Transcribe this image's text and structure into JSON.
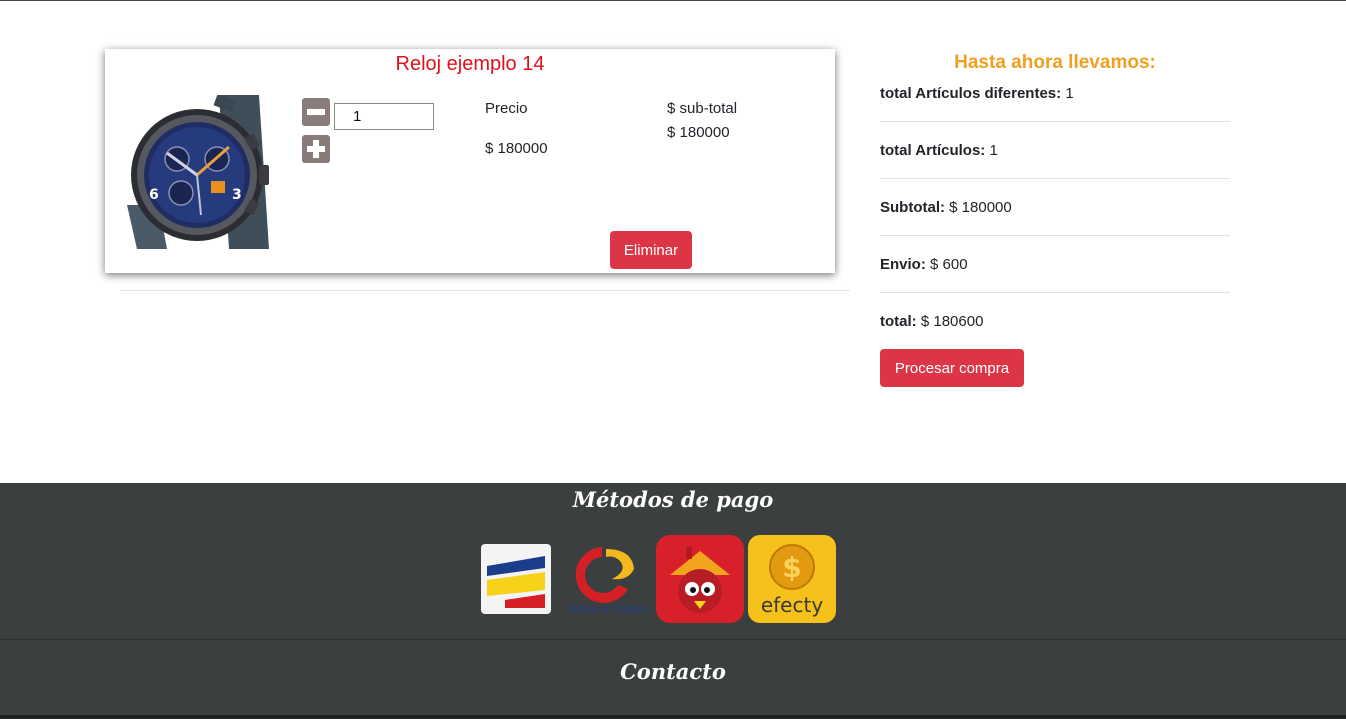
{
  "cart": {
    "item": {
      "title": "Reloj ejemplo 14",
      "quantity": "1",
      "price_label": "Precio",
      "price_value": "$ 180000",
      "subtotal_label": "$ sub-total",
      "subtotal_value": "$ 180000",
      "remove_label": "Eliminar"
    }
  },
  "summary": {
    "title": "Hasta ahora llevamos:",
    "rows": [
      {
        "label": "total Artículos diferentes:",
        "value": "1"
      },
      {
        "label": "total Artículos:",
        "value": "1"
      },
      {
        "label": "Subtotal:",
        "value": "$ 180000"
      },
      {
        "label": "Envio:",
        "value": "$ 600"
      },
      {
        "label": "total:",
        "value": "$ 180600"
      }
    ],
    "process_label": "Procesar compra"
  },
  "footer": {
    "payment_title": "Métodos de pago",
    "contact_title": "Contacto",
    "logos": [
      {
        "icon": "bancolombia-logo"
      },
      {
        "icon": "banco-de-bogota-logo",
        "text": "Banco de Bogotá"
      },
      {
        "icon": "baloto-logo"
      },
      {
        "icon": "efecty-logo",
        "text": "efecty"
      }
    ]
  },
  "colors": {
    "accent_red": "#dc3545",
    "title_red": "#e0101a",
    "summary_orange": "#f0a020",
    "footer_bg": "#3b3f40"
  }
}
